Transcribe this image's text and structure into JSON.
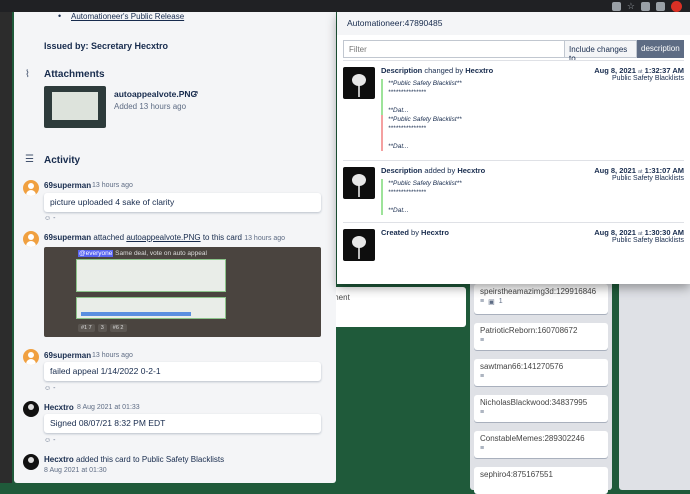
{
  "browser": {
    "profile_initial": "T"
  },
  "card": {
    "bullet_link": "Automationeer's Public Release",
    "issued_by": "Issued by: Secretary Hecxtro",
    "attachments": {
      "title": "Attachments",
      "file_name": "autoappealvote.PNG",
      "file_added": "Added 13 hours ago"
    },
    "activity": {
      "title": "Activity",
      "items": [
        {
          "user": "69superman",
          "time": "13 hours ago",
          "comment": "picture uploaded 4 sake of clarity",
          "react": "-"
        },
        {
          "user": "69superman",
          "action_prefix": "attached",
          "link": "autoappealvote.PNG",
          "action_suffix": "to this card",
          "time": "13 hours ago"
        },
        {
          "user": "69superman",
          "time": "13 hours ago",
          "comment": "failed appeal 1/14/2022 0-2-1",
          "react": "-"
        },
        {
          "user": "Hecxtro",
          "time": "8 Aug 2021 at 01:33",
          "comment": "Signed 08/07/21 8:32 PM EDT",
          "react": "-"
        },
        {
          "user": "Hecxtro",
          "action_prefix": "added this card to Public Safety Blacklists",
          "time": "8 Aug 2021 at 01:30"
        }
      ]
    },
    "image_preview": {
      "mention": "@everyone",
      "header_text": "Same deal, vote on auto appeal",
      "reactions": [
        "#1 7",
        "3",
        "#6 2"
      ]
    }
  },
  "popup": {
    "title": "Automationeer:47890485",
    "filter_placeholder": "Filter",
    "include_label": "Include changes to",
    "include_value": "description",
    "entries": [
      {
        "field": "Description",
        "verb": "changed by",
        "user": "Hecxtro",
        "date": "Aug 8, 2021",
        "at": "at",
        "time": "1:32:37 AM",
        "list": "Public Safety Blacklists",
        "removed_lines": [
          "**Public Safety Blacklist**",
          "***************",
          "",
          "**Dat..."
        ],
        "added_lines": [
          "**Public Safety Blacklist**",
          "***************",
          "",
          "**Dat..."
        ]
      },
      {
        "field": "Description",
        "verb": "added by",
        "user": "Hecxtro",
        "date": "Aug 8, 2021",
        "at": "at",
        "time": "1:31:07 AM",
        "list": "Public Safety Blacklists",
        "added_lines": [
          "**Public Safety Blacklist**",
          "***************",
          "",
          "**Dat..."
        ]
      },
      {
        "field": "Created",
        "verb": "by",
        "user": "Hecxtro",
        "date": "Aug 8, 2021",
        "at": "at",
        "time": "1:30:30 AM",
        "list": "Public Safety Blacklists"
      }
    ]
  },
  "board": {
    "partial_card": "ment",
    "cards": [
      "speirstheamazimg3d:129916846",
      "PatrioticReborn:160708672",
      "sawtman66:141270576",
      "NicholasBlackwood:34837995",
      "ConstableMemes:289302246",
      "sephiro4:875167551"
    ],
    "first_card_count": "1"
  },
  "colors": {
    "accent_gray": "#5e6c84",
    "board_bg": "#1f5a3a"
  }
}
